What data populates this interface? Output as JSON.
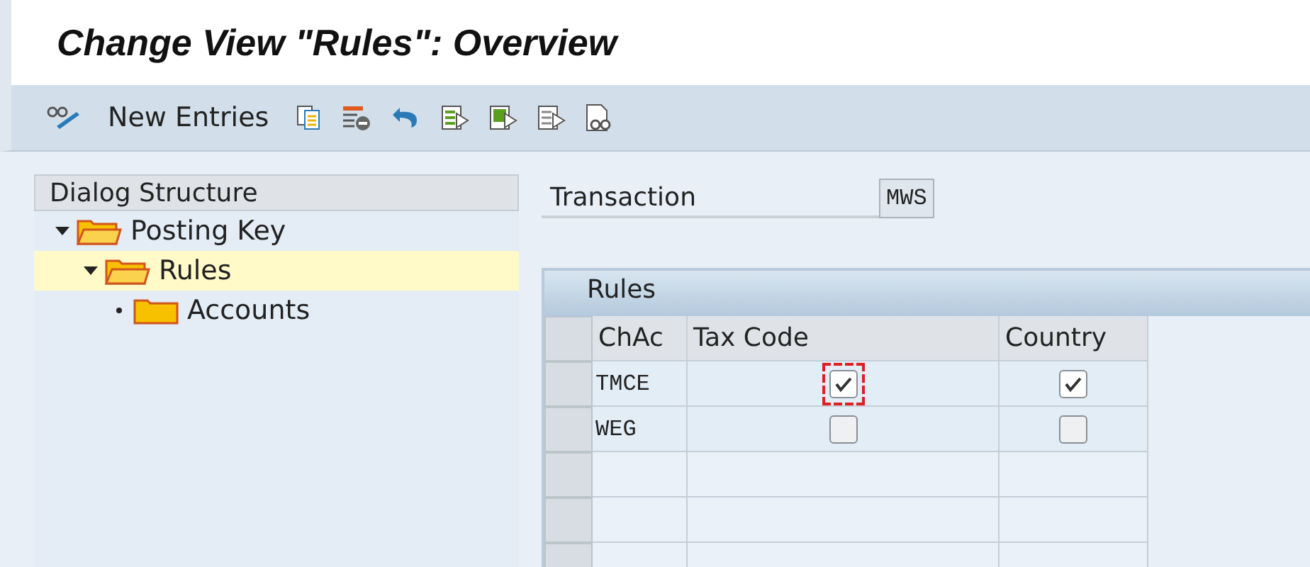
{
  "window": {
    "title": "Change View \"Rules\": Overview"
  },
  "toolbar": {
    "new_entries": "New Entries",
    "icons": [
      {
        "kind": "display-change"
      },
      {
        "kind": "copy"
      },
      {
        "kind": "delete"
      },
      {
        "kind": "undo"
      },
      {
        "kind": "select-all"
      },
      {
        "kind": "select-block"
      },
      {
        "kind": "deselect-all"
      },
      {
        "kind": "where-used"
      }
    ]
  },
  "dialog_structure": {
    "title": "Dialog Structure",
    "items": [
      {
        "label": "Posting Key",
        "expanded": true,
        "selected": false,
        "children": [
          {
            "label": "Rules",
            "expanded": true,
            "selected": true,
            "children": [
              {
                "label": "Accounts",
                "expanded": false,
                "selected": false
              }
            ]
          }
        ]
      }
    ]
  },
  "transaction": {
    "label": "Transaction",
    "value": "MWS"
  },
  "table": {
    "title": "Rules",
    "columns": [
      "ChAc",
      "Tax Code",
      "Country"
    ],
    "rows": [
      {
        "chac": "TMCE",
        "tax_code": {
          "checked": true,
          "focused": true
        },
        "country": {
          "checked": true,
          "focused": false
        }
      },
      {
        "chac": "WEG",
        "tax_code": {
          "checked": false,
          "focused": false
        },
        "country": {
          "checked": false,
          "focused": false
        }
      }
    ]
  }
}
